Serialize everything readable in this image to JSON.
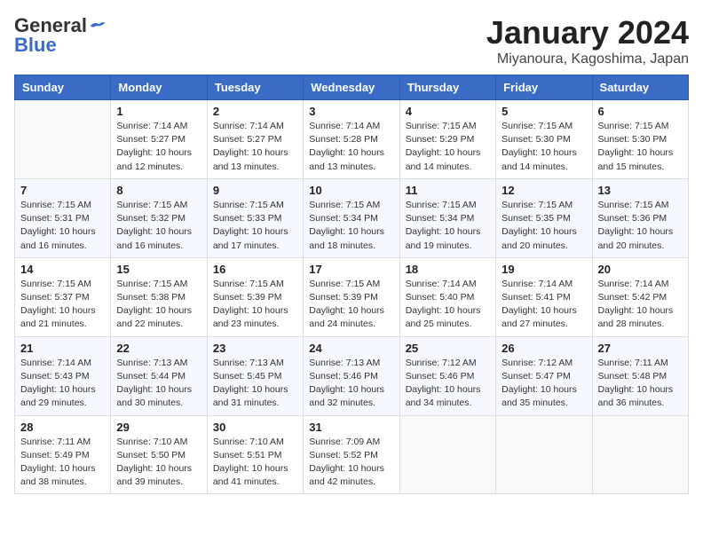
{
  "logo": {
    "text_general": "General",
    "text_blue": "Blue"
  },
  "title": "January 2024",
  "subtitle": "Miyanoura, Kagoshima, Japan",
  "headers": [
    "Sunday",
    "Monday",
    "Tuesday",
    "Wednesday",
    "Thursday",
    "Friday",
    "Saturday"
  ],
  "weeks": [
    [
      {
        "day": "",
        "info": ""
      },
      {
        "day": "1",
        "info": "Sunrise: 7:14 AM\nSunset: 5:27 PM\nDaylight: 10 hours\nand 12 minutes."
      },
      {
        "day": "2",
        "info": "Sunrise: 7:14 AM\nSunset: 5:27 PM\nDaylight: 10 hours\nand 13 minutes."
      },
      {
        "day": "3",
        "info": "Sunrise: 7:14 AM\nSunset: 5:28 PM\nDaylight: 10 hours\nand 13 minutes."
      },
      {
        "day": "4",
        "info": "Sunrise: 7:15 AM\nSunset: 5:29 PM\nDaylight: 10 hours\nand 14 minutes."
      },
      {
        "day": "5",
        "info": "Sunrise: 7:15 AM\nSunset: 5:30 PM\nDaylight: 10 hours\nand 14 minutes."
      },
      {
        "day": "6",
        "info": "Sunrise: 7:15 AM\nSunset: 5:30 PM\nDaylight: 10 hours\nand 15 minutes."
      }
    ],
    [
      {
        "day": "7",
        "info": "Sunrise: 7:15 AM\nSunset: 5:31 PM\nDaylight: 10 hours\nand 16 minutes."
      },
      {
        "day": "8",
        "info": "Sunrise: 7:15 AM\nSunset: 5:32 PM\nDaylight: 10 hours\nand 16 minutes."
      },
      {
        "day": "9",
        "info": "Sunrise: 7:15 AM\nSunset: 5:33 PM\nDaylight: 10 hours\nand 17 minutes."
      },
      {
        "day": "10",
        "info": "Sunrise: 7:15 AM\nSunset: 5:34 PM\nDaylight: 10 hours\nand 18 minutes."
      },
      {
        "day": "11",
        "info": "Sunrise: 7:15 AM\nSunset: 5:34 PM\nDaylight: 10 hours\nand 19 minutes."
      },
      {
        "day": "12",
        "info": "Sunrise: 7:15 AM\nSunset: 5:35 PM\nDaylight: 10 hours\nand 20 minutes."
      },
      {
        "day": "13",
        "info": "Sunrise: 7:15 AM\nSunset: 5:36 PM\nDaylight: 10 hours\nand 20 minutes."
      }
    ],
    [
      {
        "day": "14",
        "info": "Sunrise: 7:15 AM\nSunset: 5:37 PM\nDaylight: 10 hours\nand 21 minutes."
      },
      {
        "day": "15",
        "info": "Sunrise: 7:15 AM\nSunset: 5:38 PM\nDaylight: 10 hours\nand 22 minutes."
      },
      {
        "day": "16",
        "info": "Sunrise: 7:15 AM\nSunset: 5:39 PM\nDaylight: 10 hours\nand 23 minutes."
      },
      {
        "day": "17",
        "info": "Sunrise: 7:15 AM\nSunset: 5:39 PM\nDaylight: 10 hours\nand 24 minutes."
      },
      {
        "day": "18",
        "info": "Sunrise: 7:14 AM\nSunset: 5:40 PM\nDaylight: 10 hours\nand 25 minutes."
      },
      {
        "day": "19",
        "info": "Sunrise: 7:14 AM\nSunset: 5:41 PM\nDaylight: 10 hours\nand 27 minutes."
      },
      {
        "day": "20",
        "info": "Sunrise: 7:14 AM\nSunset: 5:42 PM\nDaylight: 10 hours\nand 28 minutes."
      }
    ],
    [
      {
        "day": "21",
        "info": "Sunrise: 7:14 AM\nSunset: 5:43 PM\nDaylight: 10 hours\nand 29 minutes."
      },
      {
        "day": "22",
        "info": "Sunrise: 7:13 AM\nSunset: 5:44 PM\nDaylight: 10 hours\nand 30 minutes."
      },
      {
        "day": "23",
        "info": "Sunrise: 7:13 AM\nSunset: 5:45 PM\nDaylight: 10 hours\nand 31 minutes."
      },
      {
        "day": "24",
        "info": "Sunrise: 7:13 AM\nSunset: 5:46 PM\nDaylight: 10 hours\nand 32 minutes."
      },
      {
        "day": "25",
        "info": "Sunrise: 7:12 AM\nSunset: 5:46 PM\nDaylight: 10 hours\nand 34 minutes."
      },
      {
        "day": "26",
        "info": "Sunrise: 7:12 AM\nSunset: 5:47 PM\nDaylight: 10 hours\nand 35 minutes."
      },
      {
        "day": "27",
        "info": "Sunrise: 7:11 AM\nSunset: 5:48 PM\nDaylight: 10 hours\nand 36 minutes."
      }
    ],
    [
      {
        "day": "28",
        "info": "Sunrise: 7:11 AM\nSunset: 5:49 PM\nDaylight: 10 hours\nand 38 minutes."
      },
      {
        "day": "29",
        "info": "Sunrise: 7:10 AM\nSunset: 5:50 PM\nDaylight: 10 hours\nand 39 minutes."
      },
      {
        "day": "30",
        "info": "Sunrise: 7:10 AM\nSunset: 5:51 PM\nDaylight: 10 hours\nand 41 minutes."
      },
      {
        "day": "31",
        "info": "Sunrise: 7:09 AM\nSunset: 5:52 PM\nDaylight: 10 hours\nand 42 minutes."
      },
      {
        "day": "",
        "info": ""
      },
      {
        "day": "",
        "info": ""
      },
      {
        "day": "",
        "info": ""
      }
    ]
  ]
}
